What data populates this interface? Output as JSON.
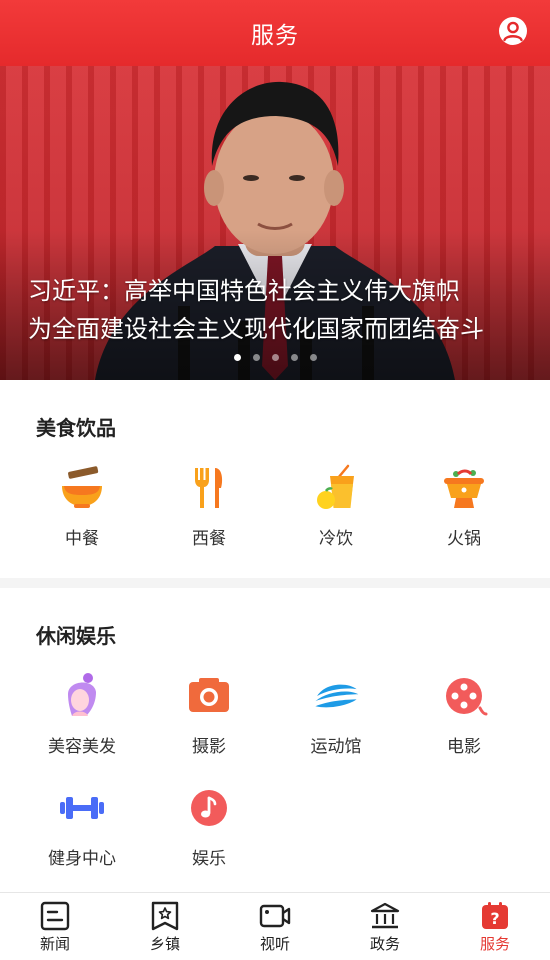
{
  "header": {
    "title": "服务",
    "profile_icon": "user-circle-icon"
  },
  "banner": {
    "headline_line1": "习近平：高举中国特色社会主义伟大旗帜",
    "headline_line2": "为全面建设社会主义现代化国家而团结奋斗",
    "slide_count": 5,
    "active_slide": 1
  },
  "food_section": {
    "title": "美食饮品",
    "items": [
      {
        "label": "中餐",
        "icon": "noodle-bowl-icon"
      },
      {
        "label": "西餐",
        "icon": "fork-knife-icon"
      },
      {
        "label": "冷饮",
        "icon": "cold-drink-icon"
      },
      {
        "label": "火锅",
        "icon": "hotpot-icon"
      }
    ]
  },
  "leisure_section": {
    "title": "休闲娱乐",
    "items": [
      {
        "label": "美容美发",
        "icon": "hairdresser-icon"
      },
      {
        "label": "摄影",
        "icon": "camera-icon"
      },
      {
        "label": "运动馆",
        "icon": "stadium-icon"
      },
      {
        "label": "电影",
        "icon": "film-reel-icon"
      },
      {
        "label": "健身中心",
        "icon": "dumbbell-icon"
      },
      {
        "label": "娱乐",
        "icon": "music-note-icon"
      }
    ]
  },
  "tabbar": {
    "tabs": [
      {
        "label": "新闻",
        "icon": "news-icon"
      },
      {
        "label": "乡镇",
        "icon": "town-bookmark-icon"
      },
      {
        "label": "视听",
        "icon": "video-camera-icon"
      },
      {
        "label": "政务",
        "icon": "government-building-icon"
      },
      {
        "label": "服务",
        "icon": "service-help-icon"
      }
    ],
    "active": "服务"
  },
  "colors": {
    "brand_red": "#e52a2c",
    "active_tab": "#e53a33"
  }
}
